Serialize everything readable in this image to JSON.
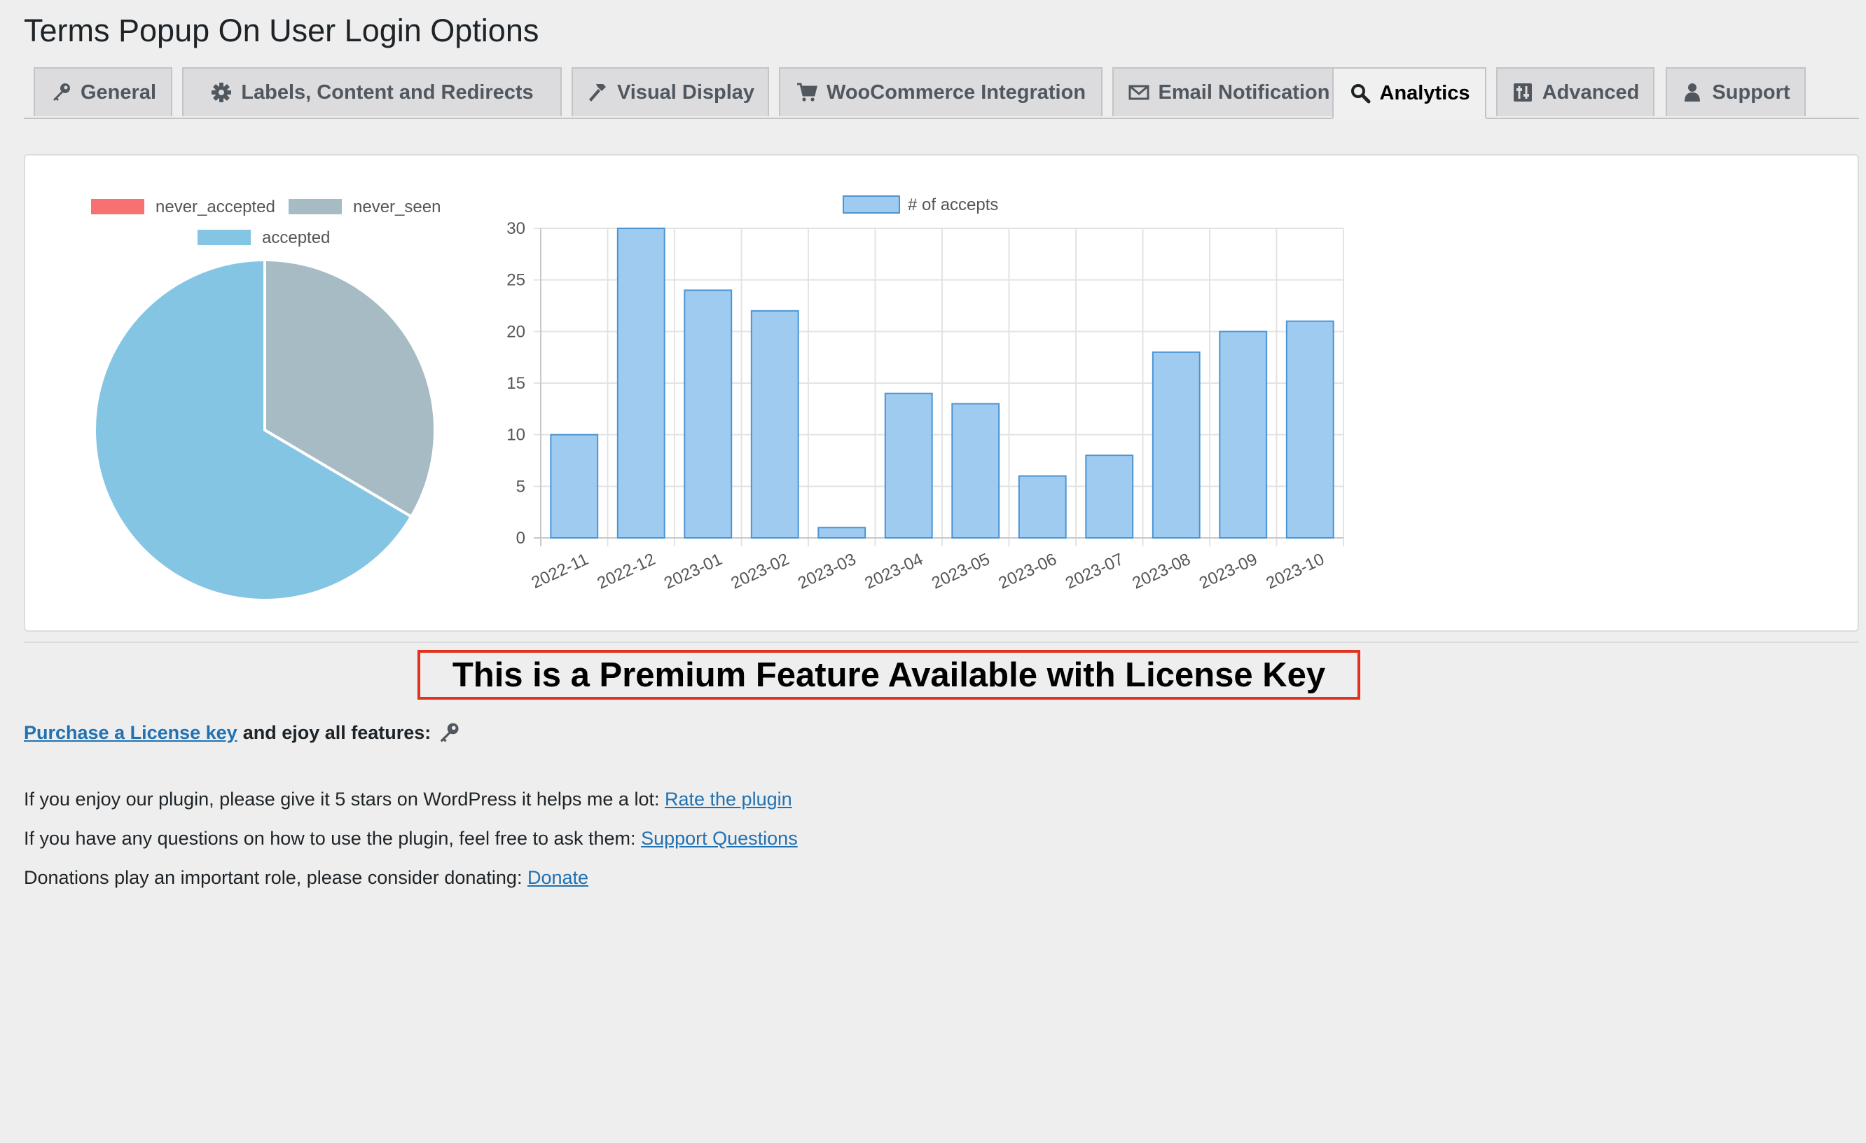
{
  "page": {
    "title": "Terms Popup On User Login Options"
  },
  "tabs": [
    {
      "label": "General",
      "icon": "key-icon",
      "active": false
    },
    {
      "label": "Labels, Content and Redirects",
      "icon": "gear-icon",
      "active": false
    },
    {
      "label": "Visual Display",
      "icon": "hammer-icon",
      "active": false
    },
    {
      "label": "WooCommerce Integration",
      "icon": "cart-icon",
      "active": false
    },
    {
      "label": "Email Notification",
      "icon": "envelope-icon",
      "active": false
    },
    {
      "label": "Analytics",
      "icon": "search-icon",
      "active": true
    },
    {
      "label": "Advanced",
      "icon": "sliders-icon",
      "active": false
    },
    {
      "label": "Support",
      "icon": "person-icon",
      "active": false
    }
  ],
  "colors": {
    "never_accepted": "#f87171",
    "never_seen": "#a6bbc3",
    "accepted": "#85c5e4",
    "bar_fill": "#a0cbf0",
    "bar_stroke": "#4a94d4",
    "premium_border": "#e0321e",
    "link": "#2271b1"
  },
  "chart_data": [
    {
      "type": "pie",
      "labels": [
        "never_accepted",
        "never_seen",
        "accepted"
      ],
      "values": [
        0,
        33.5,
        66.5
      ],
      "legend_position": "top"
    },
    {
      "type": "bar",
      "categories": [
        "2022-11",
        "2022-12",
        "2023-01",
        "2023-02",
        "2023-03",
        "2023-04",
        "2023-05",
        "2023-06",
        "2023-07",
        "2023-08",
        "2023-09",
        "2023-10"
      ],
      "series": [
        {
          "name": "# of accepts",
          "values": [
            10,
            30,
            24,
            22,
            1,
            14,
            13,
            6,
            8,
            18,
            20,
            21
          ]
        }
      ],
      "ylim": [
        0,
        30
      ],
      "yticks": [
        "0",
        "5",
        "10",
        "15",
        "20",
        "25",
        "30"
      ],
      "grid": true,
      "legend_position": "top"
    }
  ],
  "premium": {
    "text": "This is a Premium Feature Available with License Key"
  },
  "purchase": {
    "link": "Purchase a License key",
    "rest": "and ejoy all features:",
    "icon": "key-icon"
  },
  "info": [
    {
      "text": "If you enjoy our plugin, please give it 5 stars on WordPress it helps me a lot:",
      "link": "Rate the plugin"
    },
    {
      "text": "If you have any questions on how to use the plugin, feel free to ask them:",
      "link": "Support Questions"
    },
    {
      "text": "Donations play an important role, please consider donating:",
      "link": "Donate"
    }
  ]
}
